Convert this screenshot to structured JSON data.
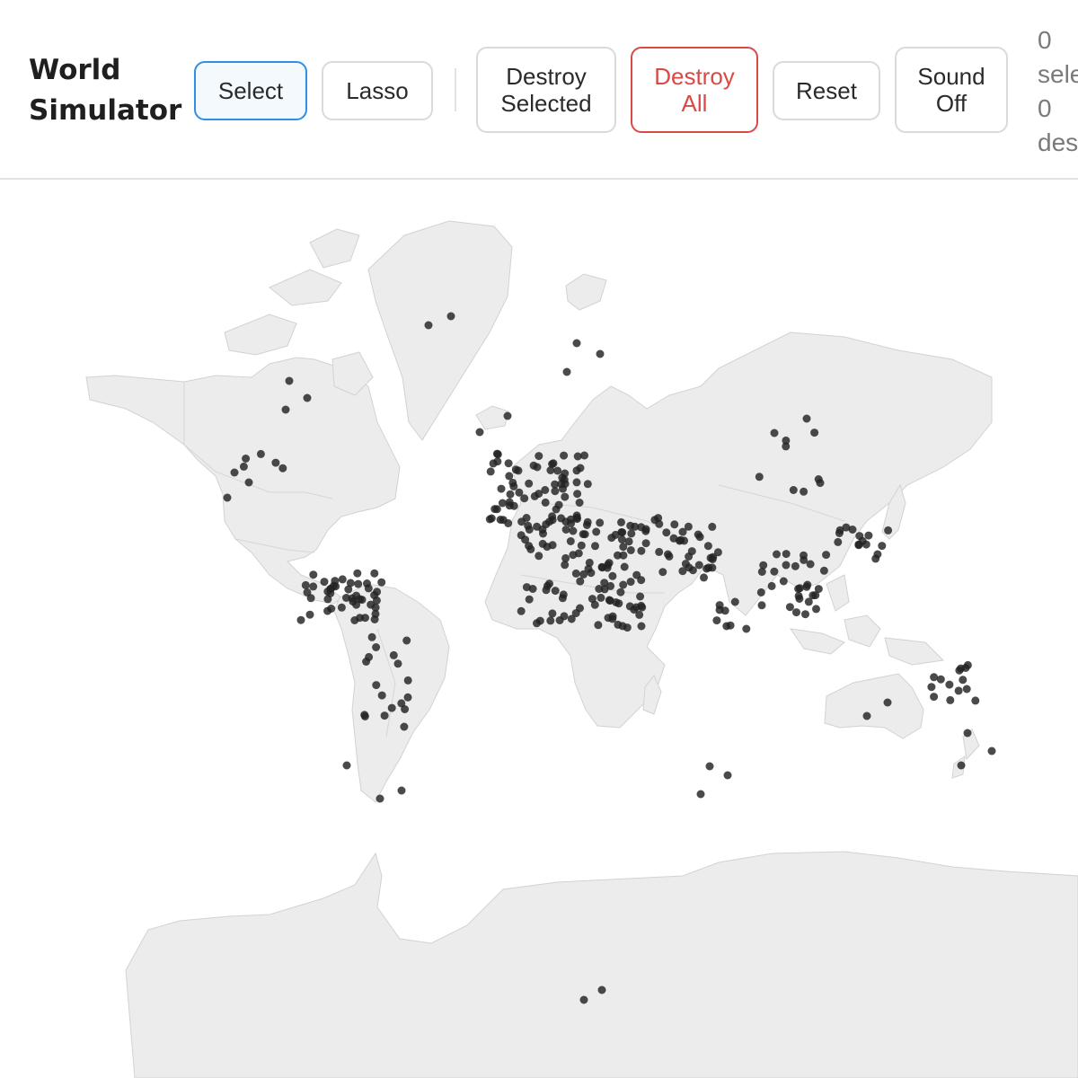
{
  "app": {
    "title_line1": "World",
    "title_line2": "Simulator"
  },
  "toolbar": {
    "select": "Select",
    "lasso": "Lasso",
    "destroy_selected": "Destroy\nSelected",
    "destroy_all": "Destroy\nAll",
    "reset": "Reset",
    "sound": "Sound\nOff"
  },
  "stats": {
    "selected_count": "0",
    "selected_label": "selected",
    "destroyed_count": "0",
    "destroyed_label": "destroyed"
  },
  "colors": {
    "accent": "#2f8fe8",
    "danger": "#d94a46",
    "land": "#ececec",
    "city": "#222222"
  }
}
